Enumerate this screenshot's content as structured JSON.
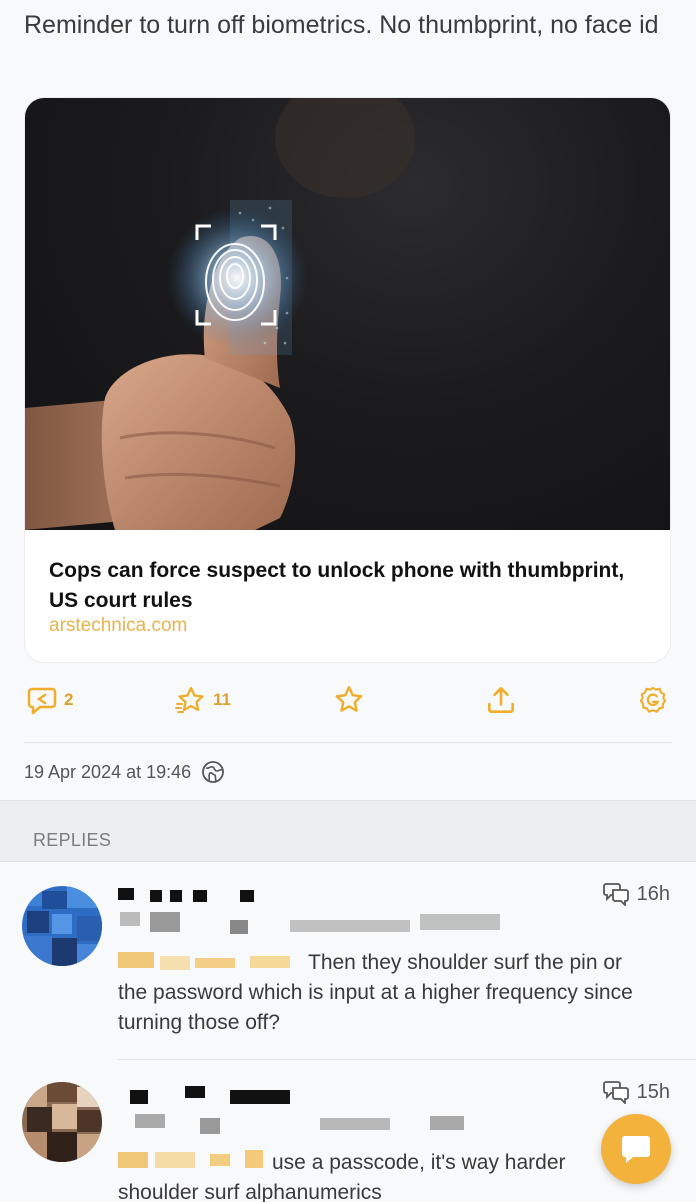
{
  "post": {
    "text": "Reminder to turn off biometrics. No thumbprint, no face id",
    "link": {
      "title": "Cops can force suspect to unlock phone with thumbprint, US court rules",
      "domain": "arstechnica.com"
    },
    "actions": {
      "replies_count": "2",
      "boosts_count": "11"
    },
    "timestamp": "19 Apr 2024 at 19:46"
  },
  "replies_header": "REPLIES",
  "replies": [
    {
      "time": "16h",
      "text_line1": "Then they shoulder surf the pin or",
      "text_rest": "the password which is input at a higher frequency since turning those off?"
    },
    {
      "time": "15h",
      "text_line1": "use a passcode, it's way harder",
      "text_rest": "shoulder surf alphanumerics"
    }
  ],
  "colors": {
    "accent": "#f0ad2a",
    "link_domain": "#e8b34a",
    "fab": "#f3b23c"
  },
  "icons": [
    "reply-icon",
    "boost-icon",
    "star-icon",
    "share-icon",
    "settings-icon",
    "globe-icon",
    "reply-count-icon",
    "compose-icon"
  ]
}
